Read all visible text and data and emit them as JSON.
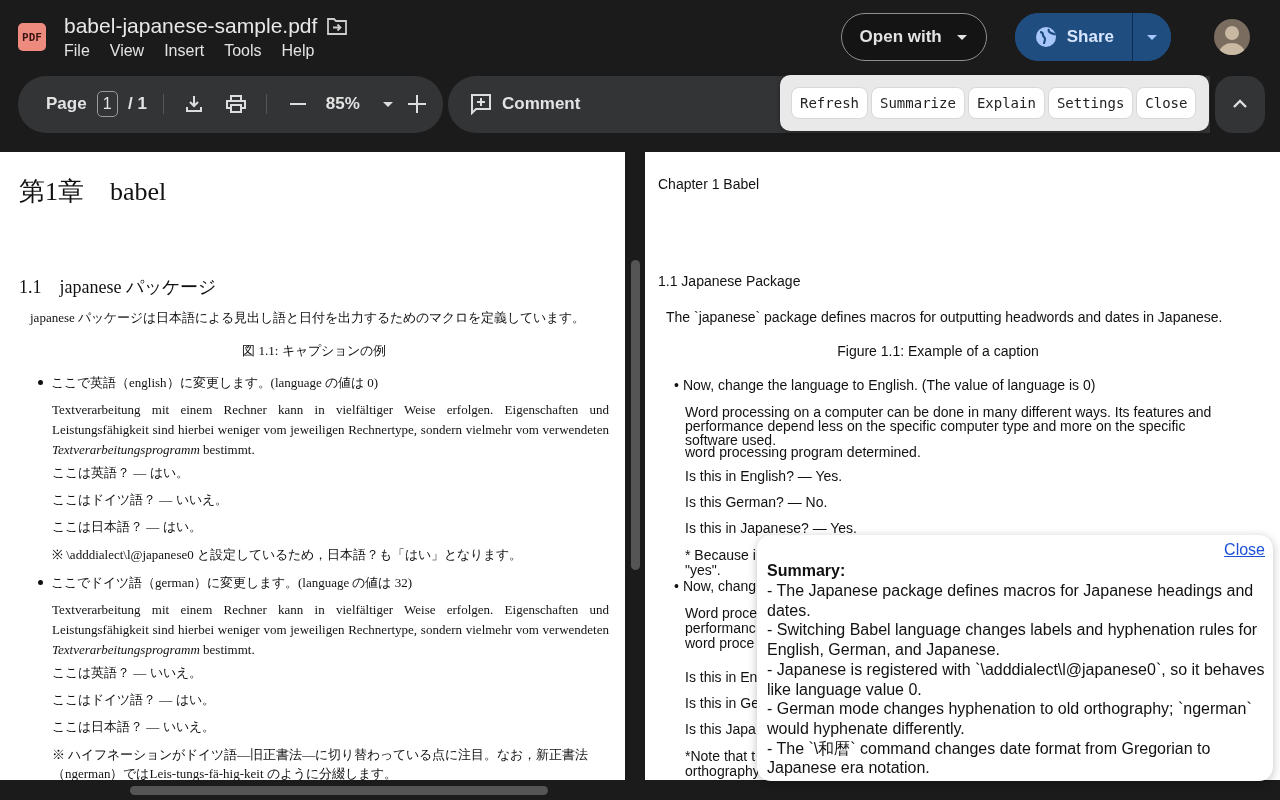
{
  "header": {
    "file_icon": "PDF",
    "title": "babel-japanese-sample.pdf",
    "menu": [
      "File",
      "View",
      "Insert",
      "Tools",
      "Help"
    ],
    "open_with": "Open with",
    "share": "Share"
  },
  "toolbar": {
    "page_label": "Page",
    "page_value": "1",
    "page_total": "/ 1",
    "zoom": "85%",
    "comment": "Comment"
  },
  "ai_toolbar": {
    "buttons": [
      "Refresh",
      "Summarize",
      "Explain",
      "Settings",
      "Close"
    ]
  },
  "left_page": {
    "chapter": "第1章　babel",
    "section": "1.1　japanese パッケージ",
    "intro": "japanese パッケージは日本語による見出し語と日付を出力するためのマクロを定義しています。",
    "caption": "図 1.1: キャプションの例",
    "bullets": [
      {
        "heading": "ここで英語（english）に変更します。(language の値は 0)",
        "paragraph": "Textverarbeitung mit einem Rechner kann in vielfältiger Weise erfolgen. Eigenschaften und Leistungsfähigkeit sind hierbei weniger vom jeweiligen Rechnertype, sondern vielmehr vom verwendeten *Textverarbeitungsprogramm* bestimmt.",
        "answers": [
          "ここは英語？ — はい。",
          "ここはドイツ語？ — いいえ。",
          "ここは日本語？ — はい。"
        ],
        "note": "※ \\adddialect\\l@japanese0 と設定しているため，日本語？も「はい」となります。"
      },
      {
        "heading": "ここでドイツ語（german）に変更します。(language の値は 32)",
        "paragraph": "Textverarbeitung mit einem Rechner kann in vielfältiger Weise erfolgen. Eigenschaften und Leistungsfähigkeit sind hierbei weniger vom jeweiligen Rechnertype, sondern vielmehr vom verwendeten *Textverarbeitungsprogramm* bestimmt.",
        "answers": [
          "ここは英語？ — いいえ。",
          "ここはドイツ語？ — はい。",
          "ここは日本語？ — いいえ。"
        ],
        "note": "※ ハイフネーションがドイツ語—旧正書法—に切り替わっている点に注目。なお，新正書法（ngerman）ではLeis-tungs-fä-hig-keit のように分綴します。"
      }
    ]
  },
  "right_page": {
    "blocks": [
      {
        "kind": "heading",
        "text": "Chapter 1 Babel"
      },
      {
        "kind": "section",
        "text": "1.1 Japanese Package"
      },
      {
        "kind": "intro",
        "text": "The `japanese` package defines macros for outputting headwords and dates in Japanese."
      },
      {
        "kind": "caption",
        "text": "Figure 1.1: Example of a caption"
      },
      {
        "kind": "bullet",
        "marker": "•",
        "text": "Now, change the language to English. (The value of language is 0)"
      },
      {
        "kind": "para",
        "text": "Word processing on a computer can be done in many different ways. Its features and performance depend less on the specific computer type and more on the specific software used."
      },
      {
        "kind": "cont",
        "text": "word processing program determined."
      },
      {
        "kind": "line",
        "text": "Is this in English? — Yes."
      },
      {
        "kind": "line",
        "text": "Is this German? — No."
      },
      {
        "kind": "line",
        "text": "Is this in Japanese? — Yes."
      },
      {
        "kind": "para",
        "text": "* Because i"
      },
      {
        "kind": "wrap",
        "text": "\"yes\"."
      },
      {
        "kind": "nextbullet",
        "marker": "•",
        "text": "Now, chang"
      },
      {
        "kind": "para",
        "text": "Word proce"
      },
      {
        "kind": "wrap",
        "text": "performanc"
      },
      {
        "kind": "wrap",
        "text": "word proce"
      },
      {
        "kind": "gap",
        "text": "Is this in En"
      },
      {
        "kind": "line",
        "text": "Is this in Ge"
      },
      {
        "kind": "line",
        "text": "Is this Japa"
      },
      {
        "kind": "para",
        "text": "*Note that t"
      },
      {
        "kind": "wrap",
        "text": "orthography"
      }
    ]
  },
  "summary_popup": {
    "close": "Close",
    "title": "Summary:",
    "lines": [
      "- The Japanese package defines macros for Japanese headings and dates.",
      "- Switching Babel language changes labels and hyphenation rules for English, German, and Japanese.",
      "- Japanese is registered with `\\adddialect\\l@japanese0`, so it behaves like language value 0.",
      "- German mode changes hyphenation to old orthography; `ngerman` would hyphenate differently.",
      "- The `\\和暦` command changes date format from Gregorian to Japanese era notation."
    ]
  }
}
